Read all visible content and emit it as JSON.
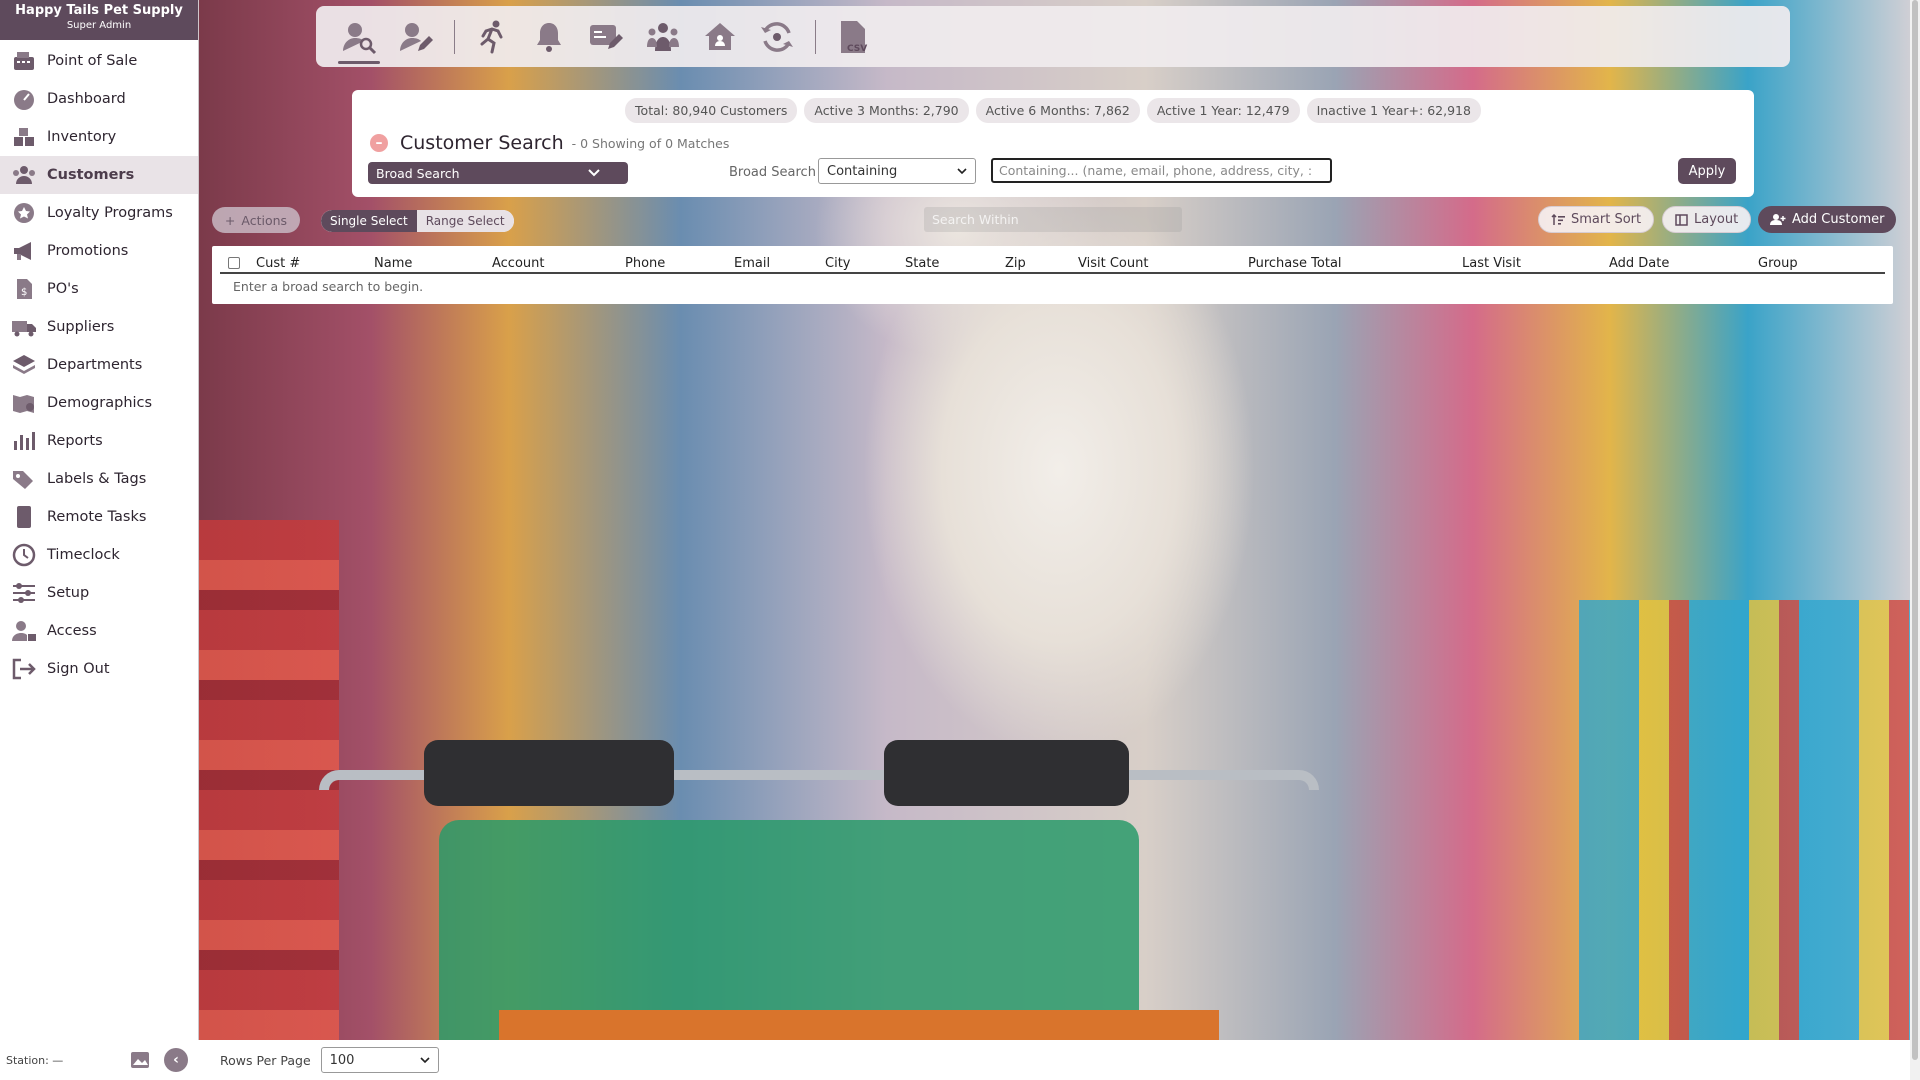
{
  "brand": {
    "name": "Happy Tails Pet Supply",
    "role": "Super Admin"
  },
  "sidebar": {
    "items": [
      {
        "label": "Point of Sale",
        "icon": "register-icon"
      },
      {
        "label": "Dashboard",
        "icon": "gauge-icon"
      },
      {
        "label": "Inventory",
        "icon": "boxes-icon"
      },
      {
        "label": "Customers",
        "icon": "users-icon",
        "active": true
      },
      {
        "label": "Loyalty Programs",
        "icon": "loyalty-icon"
      },
      {
        "label": "Promotions",
        "icon": "megaphone-icon"
      },
      {
        "label": "PO's",
        "icon": "purchase-order-icon"
      },
      {
        "label": "Suppliers",
        "icon": "truck-icon"
      },
      {
        "label": "Departments",
        "icon": "layers-icon"
      },
      {
        "label": "Demographics",
        "icon": "map-pin-icon"
      },
      {
        "label": "Reports",
        "icon": "bar-chart-icon"
      },
      {
        "label": "Labels & Tags",
        "icon": "tags-icon"
      },
      {
        "label": "Remote Tasks",
        "icon": "tablet-icon"
      },
      {
        "label": "Timeclock",
        "icon": "clock-icon"
      },
      {
        "label": "Setup",
        "icon": "sliders-icon"
      },
      {
        "label": "Access",
        "icon": "user-lock-icon"
      },
      {
        "label": "Sign Out",
        "icon": "sign-out-icon"
      }
    ],
    "footer": {
      "station": "Station: —"
    }
  },
  "toolbar": {
    "buttons": [
      {
        "icon": "customer-search-icon",
        "active": true
      },
      {
        "icon": "customer-edit-icon"
      },
      {
        "icon": "running-person-icon"
      },
      {
        "icon": "bell-icon"
      },
      {
        "icon": "message-edit-icon"
      },
      {
        "icon": "group-icon"
      },
      {
        "icon": "home-icon"
      },
      {
        "icon": "refresh-icon"
      },
      {
        "icon": "csv-file-icon"
      }
    ]
  },
  "stats": [
    "Total: 80,940 Customers",
    "Active 3 Months: 2,790",
    "Active 6 Months: 7,862",
    "Active 1 Year: 12,479",
    "Inactive 1 Year+: 62,918"
  ],
  "search": {
    "title": "Customer Search",
    "matches": "- 0 Showing of 0 Matches",
    "type_selected": "Broad Search",
    "broad_label": "Broad Search",
    "mode_selected": "Containing",
    "placeholder": "Containing... (name, email, phone, address, city, :",
    "apply": "Apply"
  },
  "actions": {
    "actions_label": "Actions",
    "single_select": "Single Select",
    "range_select": "Range Select",
    "search_within_placeholder": "Search Within",
    "smart_sort": "Smart Sort",
    "layout": "Layout",
    "add_customer": "Add Customer"
  },
  "table": {
    "columns": [
      "Cust #",
      "Name",
      "Account",
      "Phone",
      "Email",
      "City",
      "State",
      "Zip",
      "Visit Count",
      "Purchase Total",
      "Last Visit",
      "Add Date",
      "Group"
    ],
    "empty_message": "Enter a broad search to begin."
  },
  "pagination": {
    "label": "Rows Per Page",
    "value": "100"
  },
  "colors": {
    "accent": "#5e4a5c",
    "sidebar_active_bg": "#e9e3e7"
  }
}
